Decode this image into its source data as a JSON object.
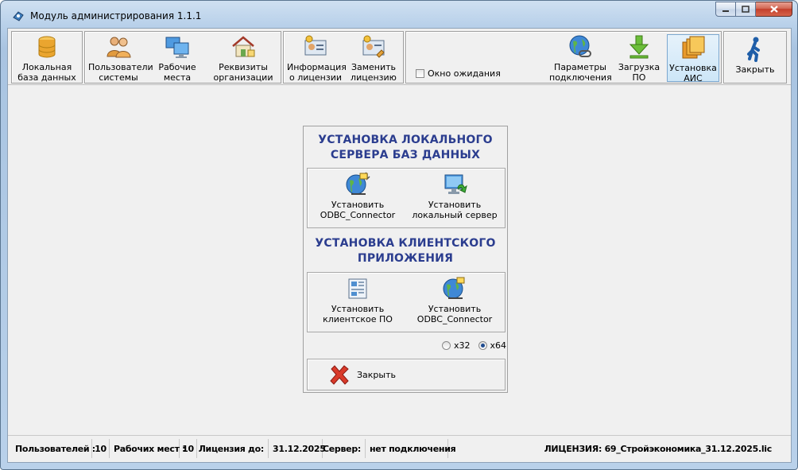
{
  "window": {
    "title": "Модуль администрирования 1.1.1"
  },
  "toolbar": {
    "local_db": "Локальная\nбаза данных",
    "users": "Пользователи\nсистемы",
    "workplaces": "Рабочие\nместа",
    "org_details": "Реквизиты\nорганизации",
    "license_info": "Информация\nо лицензии",
    "replace_license": "Заменить\nлицензию",
    "wait_window": "Окно ожидания",
    "connection_params": "Параметры\nподключения",
    "download_software": "Загрузка\nПО",
    "install_ais": "Установка\nАИС",
    "close": "Закрыть"
  },
  "panel": {
    "server_title": "УСТАНОВКА ЛОКАЛЬНОГО\nСЕРВЕРА БАЗ ДАННЫХ",
    "install_odbc": "Установить\nODBC_Connector",
    "install_local_server": "Установить\nлокальный сервер",
    "client_title": "УСТАНОВКА КЛИЕНТСКОГО\nПРИЛОЖЕНИЯ",
    "install_client": "Установить\nклиентское ПО",
    "install_odbc_client": "Установить\nODBC_Connector",
    "arch_x32": "x32",
    "arch_x64": "x64",
    "arch_selected": "x64",
    "close": "Закрыть"
  },
  "status": {
    "users_label": "Пользователей :",
    "users_value": "10",
    "workplaces_label": "Рабочих мест :",
    "workplaces_value": "10",
    "license_label": "Лицензия до:",
    "license_value": "31.12.2025",
    "server_label": "Сервер:",
    "server_value": "нет подключения",
    "license_file": "ЛИЦЕНЗИЯ: 69_Стройэкономика_31.12.2025.lic"
  },
  "colors": {
    "section_title": "#2b3d8f",
    "active_button": "#cde6f7",
    "frame": "#b9d1ea"
  }
}
